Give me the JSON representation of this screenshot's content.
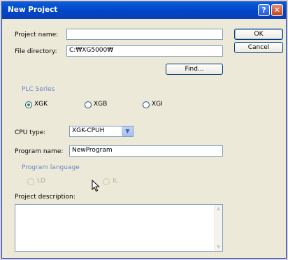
{
  "window": {
    "title": "New Project",
    "help_icon": "?",
    "close_icon": "✕"
  },
  "fields": {
    "project_name_label": "Project name:",
    "project_name_value": "",
    "file_directory_label": "File directory:",
    "file_directory_value": "C:₩XG5000₩",
    "find_button": "Find...",
    "plc_series_title": "PLC Series",
    "plc_options": [
      "XGK",
      "XGB",
      "XGI"
    ],
    "plc_selected": "XGK",
    "cpu_type_label": "CPU type:",
    "cpu_type_value": "XGK-CPUH",
    "program_name_label": "Program name:",
    "program_name_value": "NewProgram",
    "program_language_title": "Program language",
    "language_options": [
      "LD",
      "IL"
    ],
    "project_description_label": "Project description:",
    "project_description_value": ""
  },
  "buttons": {
    "ok": "OK",
    "cancel": "Cancel"
  },
  "icons": {
    "cursor": "mouse-pointer-icon",
    "scroll_up": "▲",
    "scroll_down": "▼",
    "dropdown": "▼"
  }
}
